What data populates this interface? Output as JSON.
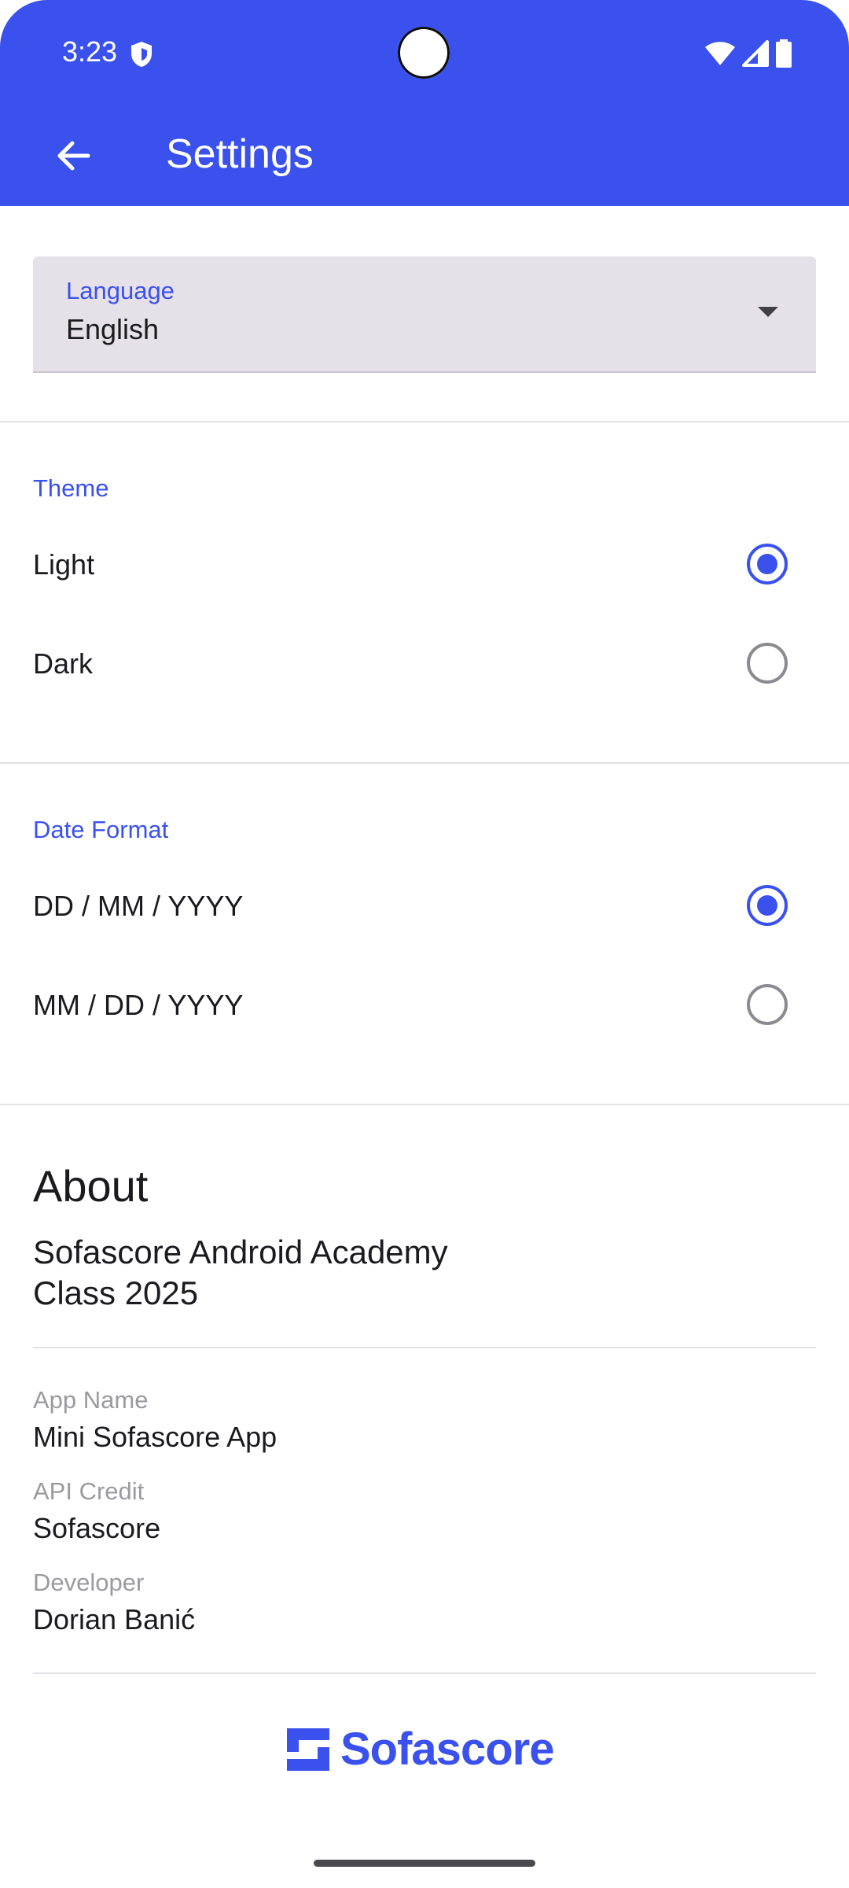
{
  "status_bar": {
    "time": "3:23"
  },
  "app_bar": {
    "title": "Settings"
  },
  "language": {
    "label": "Language",
    "value": "English"
  },
  "theme": {
    "title": "Theme",
    "options": [
      {
        "label": "Light",
        "selected": true
      },
      {
        "label": "Dark",
        "selected": false
      }
    ]
  },
  "date_format": {
    "title": "Date Format",
    "options": [
      {
        "label": "DD / MM / YYYY",
        "selected": true
      },
      {
        "label": "MM / DD / YYYY",
        "selected": false
      }
    ]
  },
  "about": {
    "heading": "About",
    "organization": "Sofascore Android Academy",
    "class": "Class 2025",
    "fields": [
      {
        "key": "App Name",
        "value": "Mini Sofascore App"
      },
      {
        "key": "API Credit",
        "value": "Sofascore"
      },
      {
        "key": "Developer",
        "value": "Dorian Banić"
      }
    ]
  },
  "logo": {
    "text": "Sofascore"
  },
  "colors": {
    "accent": "#3a51ee",
    "surface": "#e6e1e8"
  }
}
